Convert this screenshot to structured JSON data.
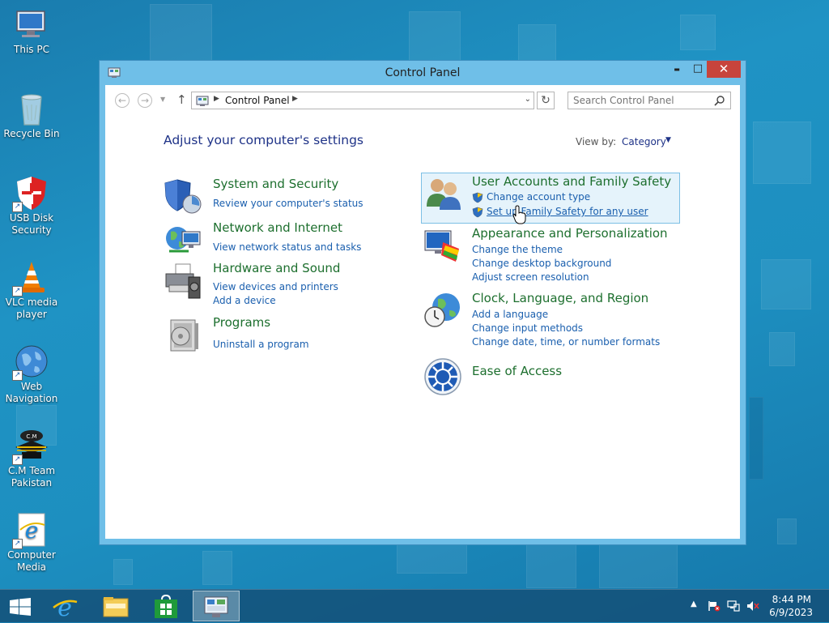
{
  "desktop": {
    "icons": [
      {
        "label": "This PC"
      },
      {
        "label": "Recycle Bin"
      },
      {
        "label": "USB Disk Security"
      },
      {
        "label": "VLC media player"
      },
      {
        "label": "Web Navigation"
      },
      {
        "label": "C.M Team Pakistan"
      },
      {
        "label": "Computer Media"
      }
    ]
  },
  "window": {
    "title": "Control Panel",
    "minimize_glyph": "▬",
    "maximize_glyph": "□",
    "close_glyph": "✕"
  },
  "address_bar": {
    "path": "Control Panel",
    "search_placeholder": "Search Control Panel"
  },
  "main": {
    "title": "Adjust your computer's settings",
    "view_by_label": "View by:",
    "view_by_value": "Category",
    "categories": [
      {
        "title": "System and Security",
        "links": [
          "Review your computer's status"
        ]
      },
      {
        "title": "Network and Internet",
        "links": [
          "View network status and tasks"
        ]
      },
      {
        "title": "Hardware and Sound",
        "links": [
          "View devices and printers",
          "Add a device"
        ]
      },
      {
        "title": "Programs",
        "links": [
          "Uninstall a program"
        ]
      },
      {
        "title": "User Accounts and Family Safety",
        "links": [
          "Change account type",
          "Set up Family Safety for any user"
        ]
      },
      {
        "title": "Appearance and Personalization",
        "links": [
          "Change the theme",
          "Change desktop background",
          "Adjust screen resolution"
        ]
      },
      {
        "title": "Clock, Language, and Region",
        "links": [
          "Add a language",
          "Change input methods",
          "Change date, time, or number formats"
        ]
      },
      {
        "title": "Ease of Access",
        "links": []
      }
    ]
  },
  "taskbar": {
    "clock_time": "8:44 PM",
    "clock_date": "6/9/2023"
  },
  "colors": {
    "link": "#1a5fae",
    "category_title": "#1d6f2e",
    "page_title": "#1e3287",
    "close_button": "#c7443c"
  }
}
